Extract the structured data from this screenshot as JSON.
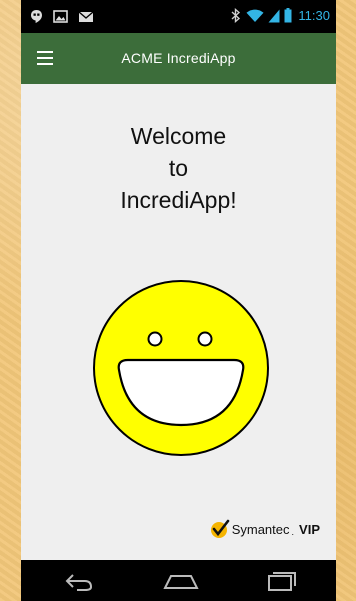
{
  "status_bar": {
    "time": "11:30",
    "icons_left": [
      "hangouts-icon",
      "gallery-icon",
      "gmail-icon"
    ],
    "icons_right": [
      "bluetooth-icon",
      "wifi-icon",
      "signal-icon",
      "battery-icon"
    ]
  },
  "app_bar": {
    "title": "ACME IncrediApp",
    "menu_icon": "hamburger-menu-icon",
    "background": "#3c6d3a"
  },
  "main": {
    "welcome_lines": [
      "Welcome",
      "to",
      "IncrediApp!"
    ],
    "image_icon": "smiley-face-icon",
    "smiley_color": "#ffff00"
  },
  "branding": {
    "name": "Symantec",
    "suffix": "VIP",
    "logo_icon": "checkmark-logo-icon"
  },
  "nav_bar": {
    "buttons": [
      "back-icon",
      "home-icon",
      "recents-icon"
    ]
  }
}
